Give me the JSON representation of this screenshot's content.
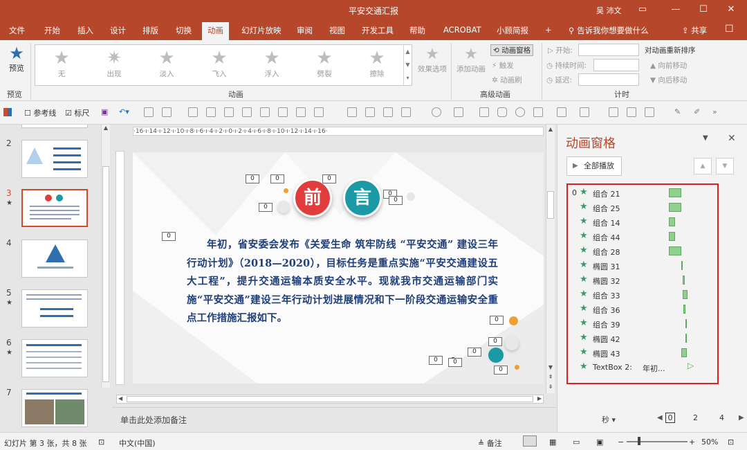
{
  "window": {
    "title": "平安交通汇报",
    "user": "吴 沛文",
    "controls": [
      "▭",
      "—",
      "☐",
      "✕"
    ]
  },
  "ribbon_tabs": [
    {
      "label": "文件"
    },
    {
      "label": "开始"
    },
    {
      "label": "插入"
    },
    {
      "label": "设计"
    },
    {
      "label": "排版"
    },
    {
      "label": "切换"
    },
    {
      "label": "动画"
    },
    {
      "label": "幻灯片放映"
    },
    {
      "label": "审阅"
    },
    {
      "label": "视图"
    },
    {
      "label": "开发工具"
    },
    {
      "label": "帮助"
    },
    {
      "label": "ACROBAT"
    },
    {
      "label": "小顾简报"
    },
    {
      "label": "+"
    }
  ],
  "active_tab": "动画",
  "tell_me": "告诉我你想要做什么",
  "share": "共享",
  "ribbon": {
    "preview_label": "预览",
    "preview_group": "预览",
    "animation_group": "动画",
    "advanced_group": "高级动画",
    "timing_group": "计时",
    "gallery": [
      {
        "label": "无"
      },
      {
        "label": "出现"
      },
      {
        "label": "淡入"
      },
      {
        "label": "飞入"
      },
      {
        "label": "浮入"
      },
      {
        "label": "劈裂"
      },
      {
        "label": "擦除"
      }
    ],
    "effect_options": "效果选项",
    "add_animation": "添加动画",
    "animation_pane": "动画窗格",
    "trigger": "触发",
    "animation_painter": "动画刷",
    "start": "开始:",
    "duration": "持续时间:",
    "delay": "延迟:",
    "reorder": "对动画重新排序",
    "move_earlier": "向前移动",
    "move_later": "向后移动"
  },
  "toolbar2": {
    "guides": "参考线",
    "ruler": "标尺",
    "guides_checked": false,
    "ruler_checked": true
  },
  "thumbnails": [
    {
      "num": "2",
      "star": ""
    },
    {
      "num": "3",
      "star": "★"
    },
    {
      "num": "4",
      "star": ""
    },
    {
      "num": "5",
      "star": "★"
    },
    {
      "num": "6",
      "star": "★"
    },
    {
      "num": "7",
      "star": ""
    }
  ],
  "selected_slide": "3",
  "ruler_h_text": "·16·ı·14·ı·12·ı·10·ı·8·ı·6·ı·4·ı·2·ı·0·ı·2·ı·4·ı·6·ı·8·ı·10·ı·12·ı·14·ı·16·",
  "slide": {
    "title_char1": "前",
    "title_char2": "言",
    "body": "年初，省安委会发布《关爱生命 筑牢防线 “平安交通” 建设三年行动计划》（2018—2020），目标任务是重点实施“平安交通建设五大工程”，提升交通运输本质安全水平。现就我市交通运输部门实施“平安交通”建设三年行动计划进展情况和下一阶段交通运输安全重点工作措施汇报如下。",
    "badges": [
      "0",
      "0",
      "0",
      "0",
      "0",
      "0",
      "0",
      "0",
      "0",
      "0",
      "0",
      "0",
      "0",
      "0"
    ]
  },
  "notes_placeholder": "单击此处添加备注",
  "animation_pane": {
    "title": "动画窗格",
    "play_all": "全部播放",
    "items": [
      {
        "num": "0",
        "label": "组合 21",
        "desc": "",
        "bar_start": 0.0,
        "bar_len": 0.6
      },
      {
        "num": "",
        "label": "组合 25",
        "desc": "",
        "bar_start": 0.0,
        "bar_len": 0.6
      },
      {
        "num": "",
        "label": "组合 14",
        "desc": "",
        "bar_start": 0.0,
        "bar_len": 0.3
      },
      {
        "num": "",
        "label": "组合 44",
        "desc": "",
        "bar_start": 0.0,
        "bar_len": 0.3
      },
      {
        "num": "",
        "label": "组合 28",
        "desc": "",
        "bar_start": 0.0,
        "bar_len": 0.6
      },
      {
        "num": "",
        "label": "椭圆 31",
        "desc": "",
        "bar_start": 0.6,
        "bar_len": 0.05
      },
      {
        "num": "",
        "label": "椭圆 32",
        "desc": "",
        "bar_start": 0.65,
        "bar_len": 0.1
      },
      {
        "num": "",
        "label": "组合 33",
        "desc": "",
        "bar_start": 0.65,
        "bar_len": 0.25
      },
      {
        "num": "",
        "label": "组合 36",
        "desc": "",
        "bar_start": 0.7,
        "bar_len": 0.1
      },
      {
        "num": "",
        "label": "组合 39",
        "desc": "",
        "bar_start": 0.8,
        "bar_len": 0.05
      },
      {
        "num": "",
        "label": "椭圆 42",
        "desc": "",
        "bar_start": 0.8,
        "bar_len": 0.05
      },
      {
        "num": "",
        "label": "椭圆 43",
        "desc": "",
        "bar_start": 0.6,
        "bar_len": 0.25
      },
      {
        "num": "",
        "label": "TextBox 2:",
        "desc": "年初...",
        "bar_start": 0.9,
        "bar_len": 0.0
      }
    ],
    "seconds_label": "秒",
    "scale_labels": [
      "0",
      "2",
      "4"
    ]
  },
  "status": {
    "slide_info": "幻灯片 第 3 张，共 8 张",
    "language": "中文(中国)",
    "notes": "备注",
    "zoom": "50%"
  },
  "colors": {
    "accent": "#b7472a",
    "slide_text": "#1f3f7a",
    "anim_bar": "#8fd08f",
    "highlight_border": "#e02020"
  }
}
